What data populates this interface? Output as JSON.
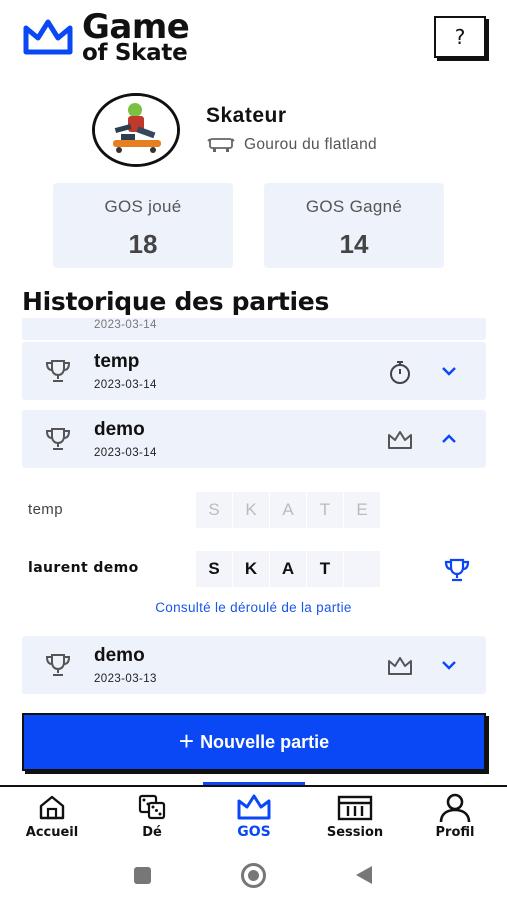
{
  "app": {
    "logo_line1": "Game",
    "logo_line2": "of Skate",
    "help_label": "?"
  },
  "profile": {
    "name": "Skateur",
    "title": "Gourou du flatland"
  },
  "stats": [
    {
      "label": "GOS joué",
      "value": "18"
    },
    {
      "label": "GOS Gagné",
      "value": "14"
    }
  ],
  "history": {
    "title": "Historique des parties",
    "partial_date": "2023-03-14",
    "games": [
      {
        "name": "temp",
        "date": "2023-03-14",
        "status_icon": "timer-icon",
        "expanded": false
      },
      {
        "name": "demo",
        "date": "2023-03-14",
        "status_icon": "crown-icon",
        "expanded": true
      },
      {
        "name": "demo",
        "date": "2023-03-13",
        "status_icon": "crown-icon",
        "expanded": false
      }
    ],
    "detail": {
      "players": [
        {
          "name": "temp",
          "letters": [
            "S",
            "K",
            "A",
            "T",
            "E"
          ],
          "earned": 0
        },
        {
          "name": "laurent demo",
          "letters": [
            "S",
            "K",
            "A",
            "T",
            ""
          ],
          "earned": 4
        }
      ],
      "link": "Consulté le déroulé de la partie"
    }
  },
  "new_game_label": "Nouvelle partie",
  "nav": [
    {
      "label": "Accueil",
      "icon": "home-icon",
      "active": false
    },
    {
      "label": "Dé",
      "icon": "dice-icon",
      "active": false
    },
    {
      "label": "GOS",
      "icon": "crown-icon",
      "active": true
    },
    {
      "label": "Session",
      "icon": "calendar-icon",
      "active": false
    },
    {
      "label": "Profil",
      "icon": "user-icon",
      "active": false
    }
  ],
  "colors": {
    "accent": "#0a47f5",
    "card_bg": "#eef2fb",
    "link": "#1a56e8"
  }
}
